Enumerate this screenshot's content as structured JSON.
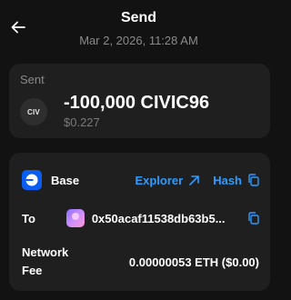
{
  "header": {
    "title": "Send",
    "timestamp": "Mar 2, 2026, 11:28 AM"
  },
  "sent": {
    "label": "Sent",
    "token_icon_text": "CIV",
    "amount": "-100,000 CIVIC96",
    "amount_usd": "$0.227"
  },
  "details": {
    "network_name": "Base",
    "explorer_label": "Explorer",
    "hash_label": "Hash",
    "to_label": "To",
    "to_address": "0x50acaf11538db63b5...",
    "fee_label_line1": "Network",
    "fee_label_line2": "Fee",
    "fee_value": "0.00000053 ETH ($0.00)"
  },
  "colors": {
    "background": "#121212",
    "card": "#1f1f1f",
    "accent": "#2d9cff",
    "base_brand": "#0b5cf0",
    "muted_text": "#8a8a8a"
  },
  "icons": [
    "back-arrow-icon",
    "external-link-icon",
    "copy-icon",
    "base-logo-icon"
  ]
}
